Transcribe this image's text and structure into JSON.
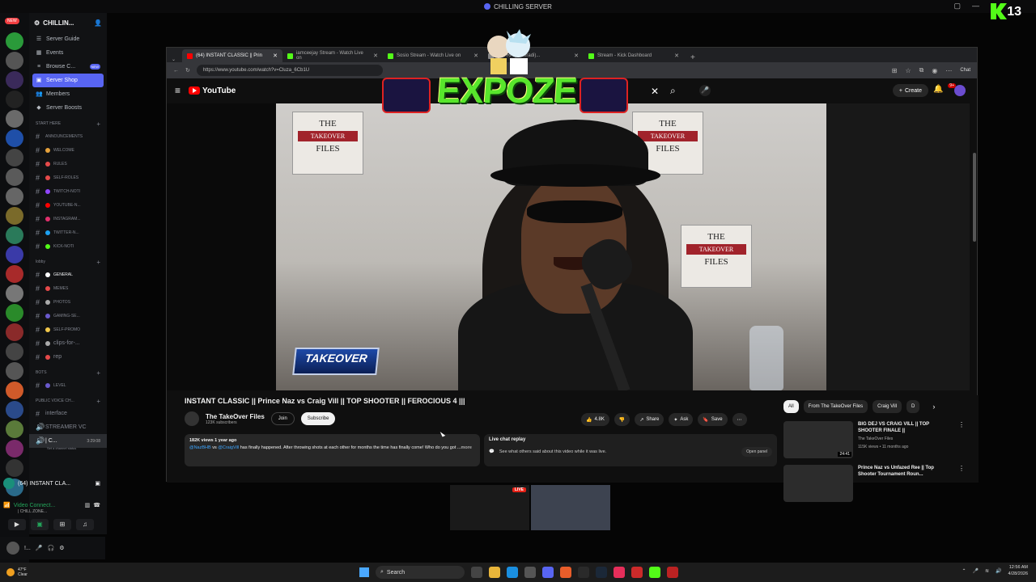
{
  "window": {
    "title": "CHILLING SERVER"
  },
  "overlay": {
    "kick_number": "13",
    "expoze_text": "EXPOZE",
    "takeover_text": "TAKEOVER"
  },
  "rail": {
    "new_badge": "NEW"
  },
  "discord": {
    "server_name": "CHILLIN...",
    "nav": [
      {
        "label": "Server Guide",
        "icon": "book-icon"
      },
      {
        "label": "Events",
        "icon": "calendar-icon"
      },
      {
        "label": "Browse C...",
        "icon": "browse-icon",
        "badge": "NEW"
      },
      {
        "label": "Server Shop",
        "icon": "shop-icon",
        "active": true
      },
      {
        "label": "Members",
        "icon": "members-icon"
      },
      {
        "label": "Server Boosts",
        "icon": "boost-icon"
      }
    ],
    "categories": {
      "start_here": "START HERE",
      "lobby": "lobby",
      "bots": "BOTS",
      "public_voice": "PUBLIC VOICE CH..."
    },
    "start_here_channels": [
      "ANNOUNCEMENTS",
      "WELCOME",
      "RULES",
      "SELF-ROLES",
      "TWITCH-NOTI",
      "YOUTUBE-N...",
      "INSTAGRAM...",
      "TWITTER-N...",
      "KICK-NOTI"
    ],
    "lobby_channels": [
      "GENERAL",
      "MEMES",
      "PHOTOS",
      "GAMING-SE...",
      "SELF-PROMO",
      "clips-for-...",
      "rep"
    ],
    "bots_channels": [
      "LEVEL"
    ],
    "voice_channels": [
      "interface",
      "STREAMER VC"
    ],
    "active_voice": {
      "name": "| C...",
      "time": "3:29:08",
      "status": "Set a channel status"
    },
    "voice_panel": {
      "activity": "(64) INSTANT CLA...",
      "connected": "Video Connect...",
      "sub": "| CHILL ZONE..."
    },
    "user": {
      "name": "!..."
    }
  },
  "browser": {
    "tabs": [
      {
        "label": "(64) INSTANT CLASSIC || Prin",
        "active": true,
        "color": "#ff0000"
      },
      {
        "label": "iamceejay Stream - Watch Live on",
        "color": "#53fc18"
      },
      {
        "label": "Sosio Stream - Watch Live on",
        "color": "#53fc18"
      },
      {
        "label": "ape RP (@beradi)...",
        "color": "#888888"
      },
      {
        "label": "Stream - Kick Dashboard",
        "color": "#53fc18"
      }
    ],
    "url": "https://www.youtube.com/watch?v=Cluza_6Cb1U",
    "chat_label": "Chat"
  },
  "youtube": {
    "logo": "YouTube",
    "create_label": "Create",
    "notif_badge": "9+",
    "video_title": "INSTANT CLASSIC || Prince Naz vs Craig Vill || TOP SHOOTER || FEROCIOUS 4 |||",
    "channel": {
      "name": "The TakeOver Files",
      "subs": "123K subscribers"
    },
    "join_label": "Join",
    "subscribe_label": "Subscribe",
    "likes": "4.8K",
    "share_label": "Share",
    "ask_label": "Ask",
    "save_label": "Save",
    "description": {
      "meta": "182K views  1 year ago",
      "handle1": "@NazBHB",
      "vs": "vs",
      "handle2": "@CraigVill",
      "text": "has finally happened. After throwing shots at each other  for  months the time has finally come! Who do you got",
      "more": "...more"
    },
    "live_chat": {
      "title": "Live chat replay",
      "text": "See what others said about this video while it was live.",
      "open_panel": "Open panel"
    },
    "chips": [
      "All",
      "From The TakeOver Files",
      "Craig Vill",
      "D"
    ],
    "related": [
      {
        "title": "BIG DEJ VS CRAIG VILL || TOP SHOOTER FINALE ||",
        "channel": "The TakeOver Files",
        "meta": "115K views • 11 months ago",
        "duration": "24:41"
      },
      {
        "title": "Prince Naz vs Unfazed Ree || Top Shooter Tournament Roun...",
        "channel": "",
        "meta": "",
        "duration": ""
      }
    ]
  },
  "cams": {
    "live_label": "LIVE"
  },
  "taskbar": {
    "weather_temp": "47°F",
    "weather_desc": "Clear",
    "search_label": "Search",
    "time": "12:56 AM",
    "date": "4/28/2026"
  }
}
